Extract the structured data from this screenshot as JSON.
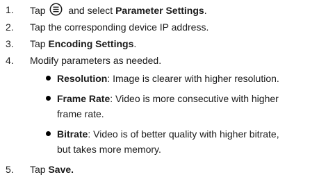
{
  "steps": [
    {
      "number": "1.",
      "pre": "Tap",
      "icon": "menu-icon",
      "post": "and select",
      "bold": "Parameter Settings",
      "end": "."
    },
    {
      "number": "2.",
      "text": "Tap the corresponding device IP address."
    },
    {
      "number": "3.",
      "pre": "Tap",
      "bold": "Encoding Settings",
      "end": "."
    },
    {
      "number": "4.",
      "text": "Modify parameters as needed."
    },
    {
      "number": "5.",
      "pre": "Tap",
      "bold": "Save."
    }
  ],
  "params": [
    {
      "term": "Resolution",
      "line1": ": Image is clearer with higher resolution.",
      "line2": ""
    },
    {
      "term": "Frame Rate",
      "line1": ": Video is more consecutive with higher",
      "line2": "frame rate."
    },
    {
      "term": "Bitrate",
      "line1": ": Video is of better quality with higher bitrate,",
      "line2": "but takes more memory."
    }
  ]
}
